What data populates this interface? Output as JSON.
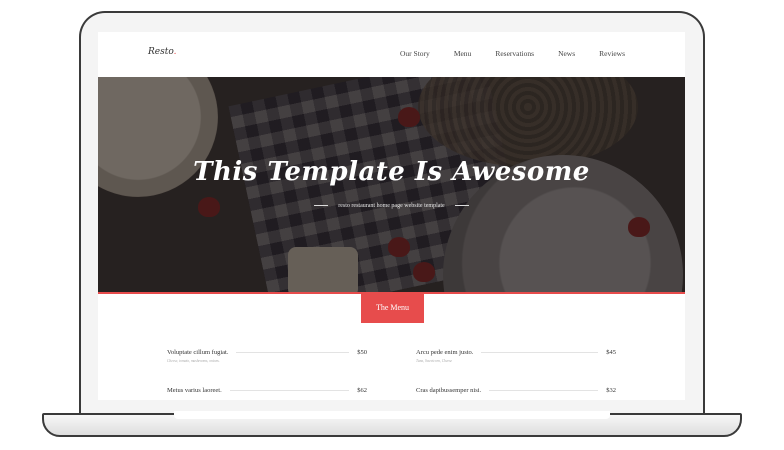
{
  "site": {
    "logo_text": "Resto",
    "logo_dot": "."
  },
  "nav": {
    "items": [
      {
        "label": "Our Story"
      },
      {
        "label": "Menu"
      },
      {
        "label": "Reservations"
      },
      {
        "label": "News"
      },
      {
        "label": "Reviews"
      }
    ]
  },
  "hero": {
    "title": "This Template Is Awesome",
    "subtitle": "resto restaurant home page website template"
  },
  "menu": {
    "badge_label": "The Menu",
    "items": [
      {
        "name": "Voluptate cillum fugiat.",
        "desc": "Cheese, tomato, mushrooms, onions.",
        "price": "$50"
      },
      {
        "name": "Arcu pede enim justo.",
        "desc": "Tuna, Sweetcorn, Cheese",
        "price": "$45"
      },
      {
        "name": "Metus varius laoreet.",
        "desc": "",
        "price": "$62"
      },
      {
        "name": "Cras dapibussemper nisi.",
        "desc": "",
        "price": "$32"
      }
    ]
  },
  "colors": {
    "accent": "#e74c4c",
    "frame": "#3a3a3a"
  }
}
